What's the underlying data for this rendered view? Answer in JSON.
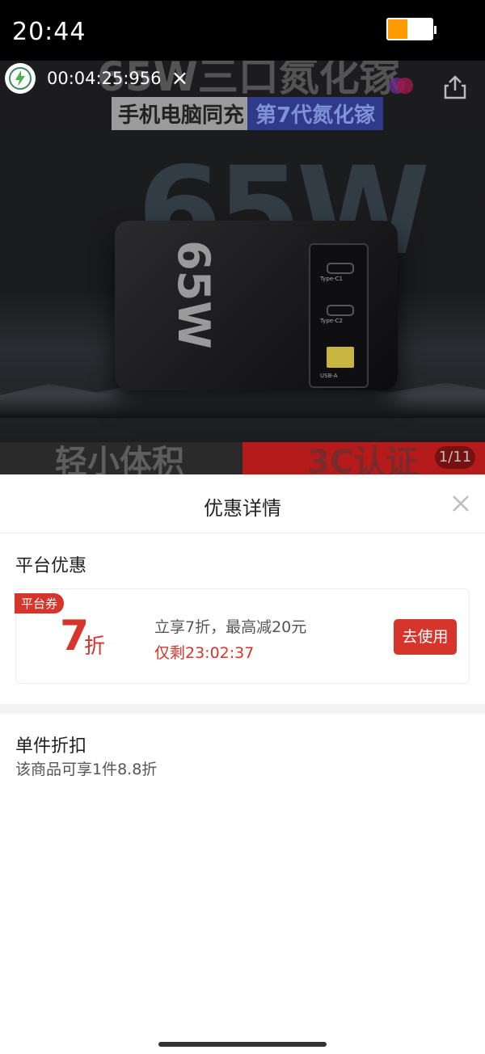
{
  "status_bar": {
    "time": "20:44",
    "battery_level": 0.45
  },
  "media": {
    "banner_top": "65W三口氮化镓",
    "tag_left": "手机电脑同充",
    "tag_right": "第7代氮化镓",
    "watt_big": "65W",
    "charger_label": "65W",
    "port_labels": [
      "Type-C1",
      "Type-C2",
      "USB-A"
    ],
    "bottom_left": "轻小体积",
    "bottom_right": "3C认证",
    "page_indicator": "1/11"
  },
  "recorder": {
    "timer": "00:04:25:956",
    "close_label": "×"
  },
  "sheet": {
    "title": "优惠详情",
    "platform_section_title": "平台优惠",
    "coupon": {
      "tag": "平台券",
      "discount_number": "7",
      "discount_unit": "折",
      "description": "立享7折，最高减20元",
      "expire_text": "仅剩23:02:37",
      "button_label": "去使用"
    },
    "item_discount": {
      "title": "单件折扣",
      "description": "该商品可享1件8.8折"
    }
  },
  "colors": {
    "accent": "#d6352b",
    "battery": "#ff9a00"
  }
}
